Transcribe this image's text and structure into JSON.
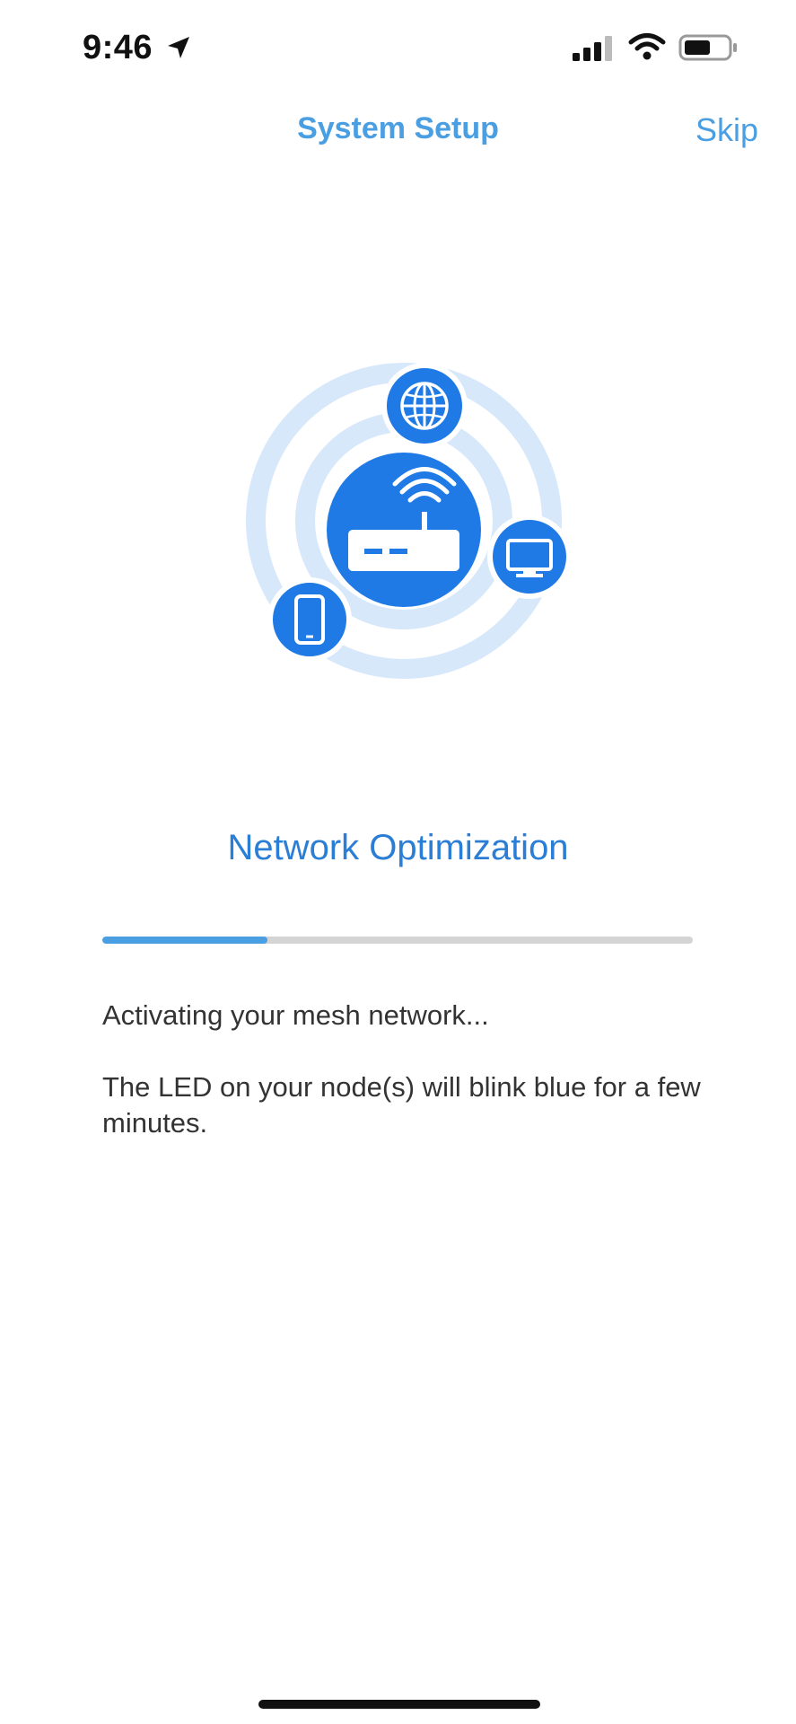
{
  "status_bar": {
    "time": "9:46",
    "icons": [
      "location-arrow-icon",
      "cellular-signal-icon",
      "wifi-icon",
      "battery-icon"
    ]
  },
  "nav": {
    "title": "System Setup",
    "skip_label": "Skip"
  },
  "illustration": {
    "icons": [
      "router-icon",
      "globe-icon",
      "monitor-icon",
      "phone-icon"
    ],
    "colors": {
      "primary": "#1f7ae6",
      "ring": "#d7e8fb"
    }
  },
  "main": {
    "section_title": "Network Optimization",
    "progress": 0.28,
    "status_text": "Activating your mesh network...",
    "info_text": "The LED on your node(s) will blink blue for a few minutes."
  },
  "colors": {
    "accent": "#4a9ee2",
    "title_blue": "#2a7ed6",
    "progress_track": "#d4d4d4"
  }
}
